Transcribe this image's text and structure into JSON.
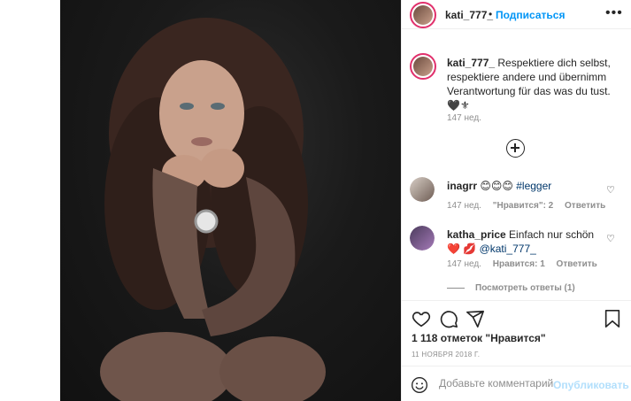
{
  "post": {
    "author": "kati_777_",
    "follow_label": "Подписаться",
    "header_separator": "•",
    "more_label": "•••",
    "caption_text": "Respektiere dich selbst, respektiere andere und übernimm Verantwortung für das was du tust. 🖤⚜",
    "caption_time": "147 нед.",
    "likes_text": "1 118 отметок \"Нравится\"",
    "date_text": "11 НОЯБРЯ 2018 Г."
  },
  "comments": [
    {
      "username": "inagrr",
      "text": "😊😊😊",
      "tag": "#legger",
      "time": "147 нед.",
      "likes": "\"Нравится\": 2",
      "reply_label": "Ответить"
    },
    {
      "username": "katha_price",
      "text": "Einfach nur schön ❤️ 💋",
      "tag": "@kati_777_",
      "time": "147 нед.",
      "likes": "Нравится: 1",
      "reply_label": "Ответить"
    }
  ],
  "replies_label": "Посмотреть ответы (1)",
  "add_comment": {
    "placeholder": "Добавьте комментарий...",
    "publish_label": "Опубликовать"
  },
  "icons": {
    "like": "heart-icon",
    "comment": "comment-icon",
    "share": "share-icon",
    "save": "bookmark-icon",
    "emoji": "emoji-icon",
    "load_more": "plus-circle-icon"
  },
  "colors": {
    "link": "#0095f6",
    "publish_disabled": "#b2dffc",
    "muted": "#8e8e8e",
    "text": "#262626",
    "story_ring": "#e1306c"
  }
}
